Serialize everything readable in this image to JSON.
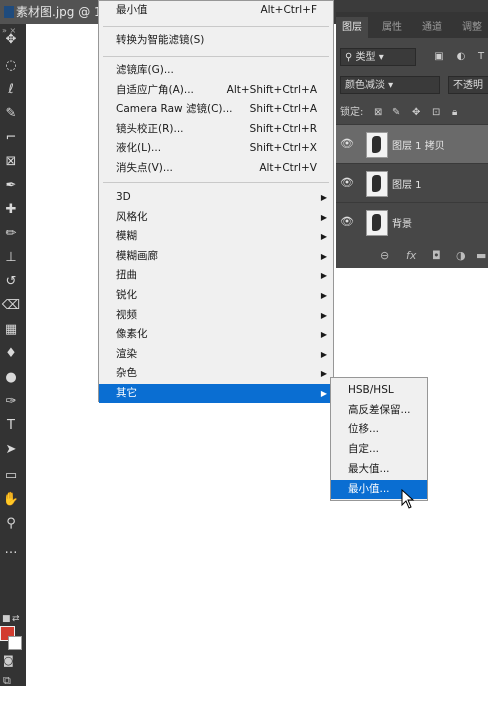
{
  "document": {
    "tab_title": "素材图.jpg @ 1"
  },
  "toolbar": {
    "tools": [
      {
        "name": "move-tool",
        "icon": "✥"
      },
      {
        "name": "marquee-tool",
        "icon": "◌"
      },
      {
        "name": "lasso-tool",
        "icon": "ℓ"
      },
      {
        "name": "quick-select-tool",
        "icon": "✎"
      },
      {
        "name": "crop-tool",
        "icon": "⌐"
      },
      {
        "name": "frame-tool",
        "icon": "⊠"
      },
      {
        "name": "eyedropper-tool",
        "icon": "✒"
      },
      {
        "name": "healing-tool",
        "icon": "✚"
      },
      {
        "name": "brush-tool",
        "icon": "✏"
      },
      {
        "name": "stamp-tool",
        "icon": "⊥"
      },
      {
        "name": "history-brush-tool",
        "icon": "↺"
      },
      {
        "name": "eraser-tool",
        "icon": "⌫"
      },
      {
        "name": "gradient-tool",
        "icon": "▦"
      },
      {
        "name": "blur-tool",
        "icon": "♦"
      },
      {
        "name": "dodge-tool",
        "icon": "●"
      },
      {
        "name": "pen-tool",
        "icon": "✑"
      },
      {
        "name": "type-tool",
        "icon": "T"
      },
      {
        "name": "path-select-tool",
        "icon": "➤"
      },
      {
        "name": "shape-tool",
        "icon": "▭"
      },
      {
        "name": "hand-tool",
        "icon": "✋"
      },
      {
        "name": "zoom-tool",
        "icon": "⚲"
      },
      {
        "name": "more-tools",
        "icon": "…"
      }
    ],
    "foreground_color": "#d23c2f",
    "background_color": "#ffffff"
  },
  "layers_panel": {
    "tabs": [
      {
        "label": "图层",
        "active": true
      },
      {
        "label": "属性",
        "active": false
      },
      {
        "label": "通道",
        "active": false
      },
      {
        "label": "调整",
        "active": false
      }
    ],
    "filter_kind": "类型",
    "blend_mode": "颜色减淡",
    "opacity_label": "不透明",
    "lock_label": "锁定:",
    "layers": [
      {
        "name": "图层 1 拷贝",
        "selected": true
      },
      {
        "name": "图层 1",
        "selected": false
      },
      {
        "name": "背景",
        "selected": false
      }
    ],
    "footer_icons": [
      "link-icon",
      "fx-icon",
      "mask-icon",
      "adjustment-icon",
      "group-icon"
    ]
  },
  "filter_menu": {
    "top_item": {
      "label": "最小值",
      "shortcut": "Alt+Ctrl+F"
    },
    "convert_smart": "转换为智能滤镜(S)",
    "group1": [
      {
        "label": "滤镜库(G)...",
        "shortcut": ""
      },
      {
        "label": "自适应广角(A)...",
        "shortcut": "Alt+Shift+Ctrl+A"
      },
      {
        "label": "Camera Raw 滤镜(C)...",
        "shortcut": "Shift+Ctrl+A"
      },
      {
        "label": "镜头校正(R)...",
        "shortcut": "Shift+Ctrl+R"
      },
      {
        "label": "液化(L)...",
        "shortcut": "Shift+Ctrl+X"
      },
      {
        "label": "消失点(V)...",
        "shortcut": "Alt+Ctrl+V"
      }
    ],
    "group2": [
      {
        "label": "3D"
      },
      {
        "label": "风格化"
      },
      {
        "label": "模糊"
      },
      {
        "label": "模糊画廊"
      },
      {
        "label": "扭曲"
      },
      {
        "label": "锐化"
      },
      {
        "label": "视频"
      },
      {
        "label": "像素化"
      },
      {
        "label": "渲染"
      },
      {
        "label": "杂色"
      },
      {
        "label": "其它",
        "highlighted": true
      }
    ]
  },
  "other_submenu": {
    "items": [
      {
        "label": "HSB/HSL"
      },
      {
        "label": "高反差保留..."
      },
      {
        "label": "位移..."
      },
      {
        "label": "自定..."
      },
      {
        "label": "最大值..."
      },
      {
        "label": "最小值...",
        "highlighted": true
      }
    ]
  },
  "colors": {
    "highlight": "#0a6ed2",
    "menu_bg": "#f0f0f0",
    "panel_bg": "#474747",
    "toolbar_bg": "#333333"
  }
}
